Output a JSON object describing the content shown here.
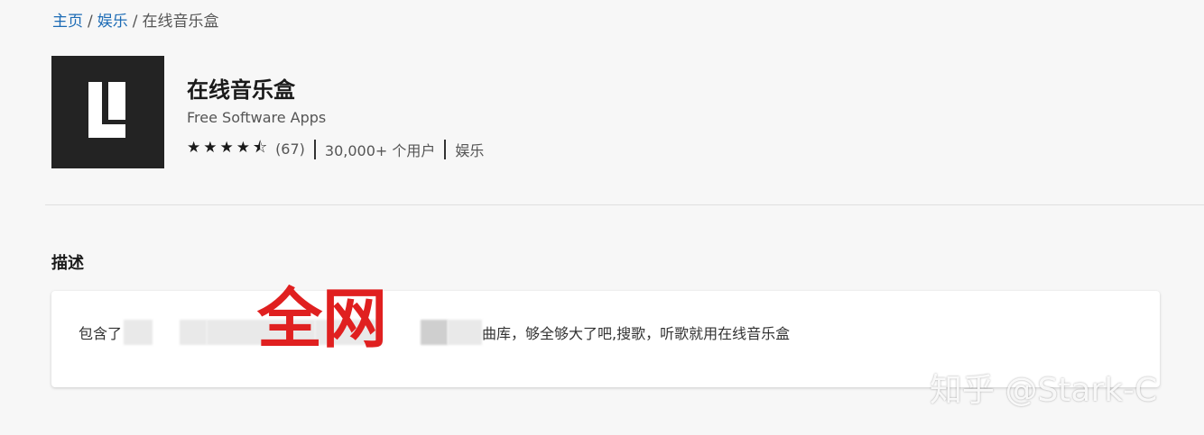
{
  "breadcrumb": {
    "home": "主页",
    "category": "娱乐",
    "current": "在线音乐盒",
    "separator": "/"
  },
  "app": {
    "title": "在线音乐盒",
    "publisher": "Free Software Apps",
    "rating_stars": "★★★★⯪",
    "rating_value": 4.5,
    "rating_count": "(67)",
    "users": "30,000+ 个用户",
    "category": "娱乐",
    "icon": "app-logo-icon"
  },
  "description": {
    "heading": "描述",
    "prefix": "包含了",
    "suffix": "曲库，够全够大了吧,搜歌，听歌就用在线音乐盒",
    "overlay": "全网"
  },
  "watermark": {
    "text": "知乎 @Stark-C"
  },
  "colors": {
    "link": "#1c6bb5",
    "overlay_red": "#e02020",
    "icon_bg": "#232323"
  }
}
